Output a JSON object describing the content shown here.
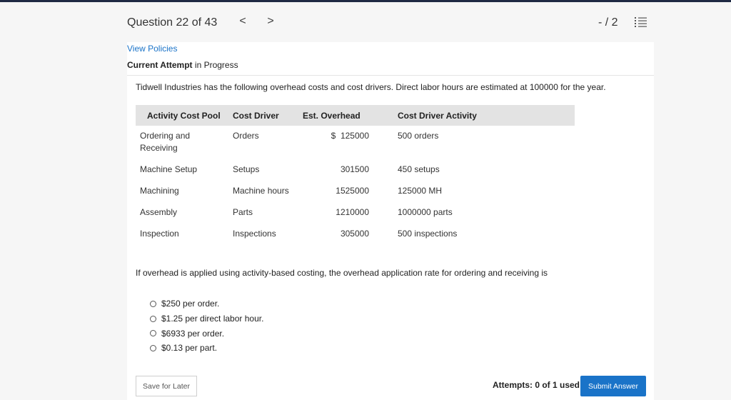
{
  "header": {
    "question_title": "Question 22 of 43",
    "prev_glyph": "<",
    "next_glyph": ">",
    "score": "- / 2"
  },
  "links": {
    "view_policies": "View Policies"
  },
  "attempt": {
    "bold": "Current Attempt",
    "rest": " in Progress"
  },
  "question": {
    "text": "Tidwell Industries has the following overhead costs and cost drivers. Direct labor hours are estimated at 100000 for the year.",
    "prompt": "If overhead is applied using activity-based costing, the overhead application rate for ordering and receiving is"
  },
  "table": {
    "headers": [
      "Activity Cost Pool",
      "Cost Driver",
      "Est. Overhead",
      "Cost Driver Activity"
    ],
    "rows": [
      [
        "Ordering and Receiving",
        "Orders",
        "$  125000",
        "500 orders"
      ],
      [
        "Machine Setup",
        "Setups",
        "301500",
        "450 setups"
      ],
      [
        "Machining",
        "Machine hours",
        "1525000",
        "125000 MH"
      ],
      [
        "Assembly",
        "Parts",
        "1210000",
        "1000000 parts"
      ],
      [
        "Inspection",
        "Inspections",
        "305000",
        "500 inspections"
      ]
    ]
  },
  "options": [
    "$250 per order.",
    "$1.25 per direct labor hour.",
    "$6933 per order.",
    "$0.13 per part."
  ],
  "footer": {
    "save_label": "Save for Later",
    "attempts_label": "Attempts: 0 of 1 used",
    "submit_label": "Submit Answer"
  },
  "colors": {
    "accent": "#1a73c8",
    "top_bar": "#1f2a44",
    "table_header_bg": "#e3e3e3"
  }
}
